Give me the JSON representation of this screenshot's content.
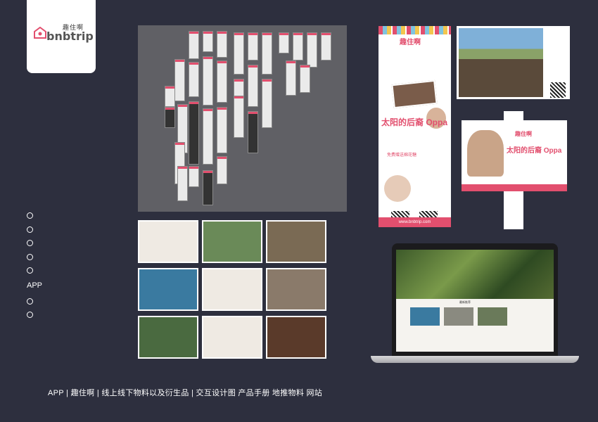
{
  "logo": {
    "cn": "趣住啊",
    "en": "bnbtrip",
    "icon": "house-pin-icon",
    "accent": "#e24f6e"
  },
  "nav": {
    "active_label": "APP"
  },
  "caption": "APP | 趣住啊 | 线上线下物料以及衍生品 | 交互设计图 产品手册 地推物料 网站",
  "colors": {
    "background": "#2d2f3e",
    "accent": "#e24f6e",
    "board": "#606065"
  },
  "rollup": {
    "brand": "趣住啊",
    "headline": "太阳的后裔 Oppa",
    "tagline": "免费赠送棉花糖",
    "url": "www.bnbtrip.com"
  },
  "sign": {
    "brand": "趣住啊",
    "headline": "太阳的后裔 Oppa"
  },
  "laptop": {
    "hero_title": "最新推荐"
  }
}
